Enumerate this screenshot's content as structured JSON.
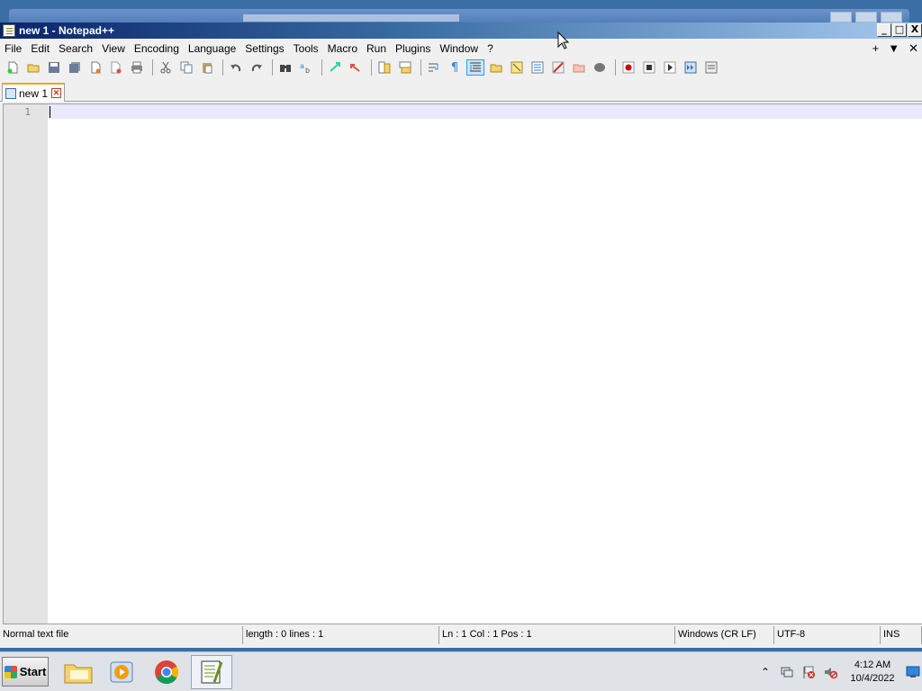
{
  "window": {
    "title": "new 1 - Notepad++",
    "controls": {
      "minimize": "_",
      "maximize": "□",
      "close": "X"
    }
  },
  "menu": {
    "items": [
      "File",
      "Edit",
      "Search",
      "View",
      "Encoding",
      "Language",
      "Settings",
      "Tools",
      "Macro",
      "Run",
      "Plugins",
      "Window",
      "?"
    ],
    "right": {
      "plus": "+",
      "dropdown": "▼",
      "close": "✕"
    }
  },
  "tab": {
    "label": "new 1"
  },
  "editor": {
    "line_numbers": [
      "1"
    ]
  },
  "statusbar": {
    "filetype": "Normal text file",
    "length": "length : 0    lines : 1",
    "position": "Ln : 1    Col : 1    Pos : 1",
    "eol": "Windows (CR LF)",
    "encoding": "UTF-8",
    "mode": "INS"
  },
  "taskbar": {
    "start_label": "Start",
    "clock": {
      "time": "4:12 AM",
      "date": "10/4/2022"
    }
  },
  "colors": {
    "current_line": "#e8e8ff",
    "tab_accent": "#f9a01b",
    "record_red": "#cc0000"
  }
}
